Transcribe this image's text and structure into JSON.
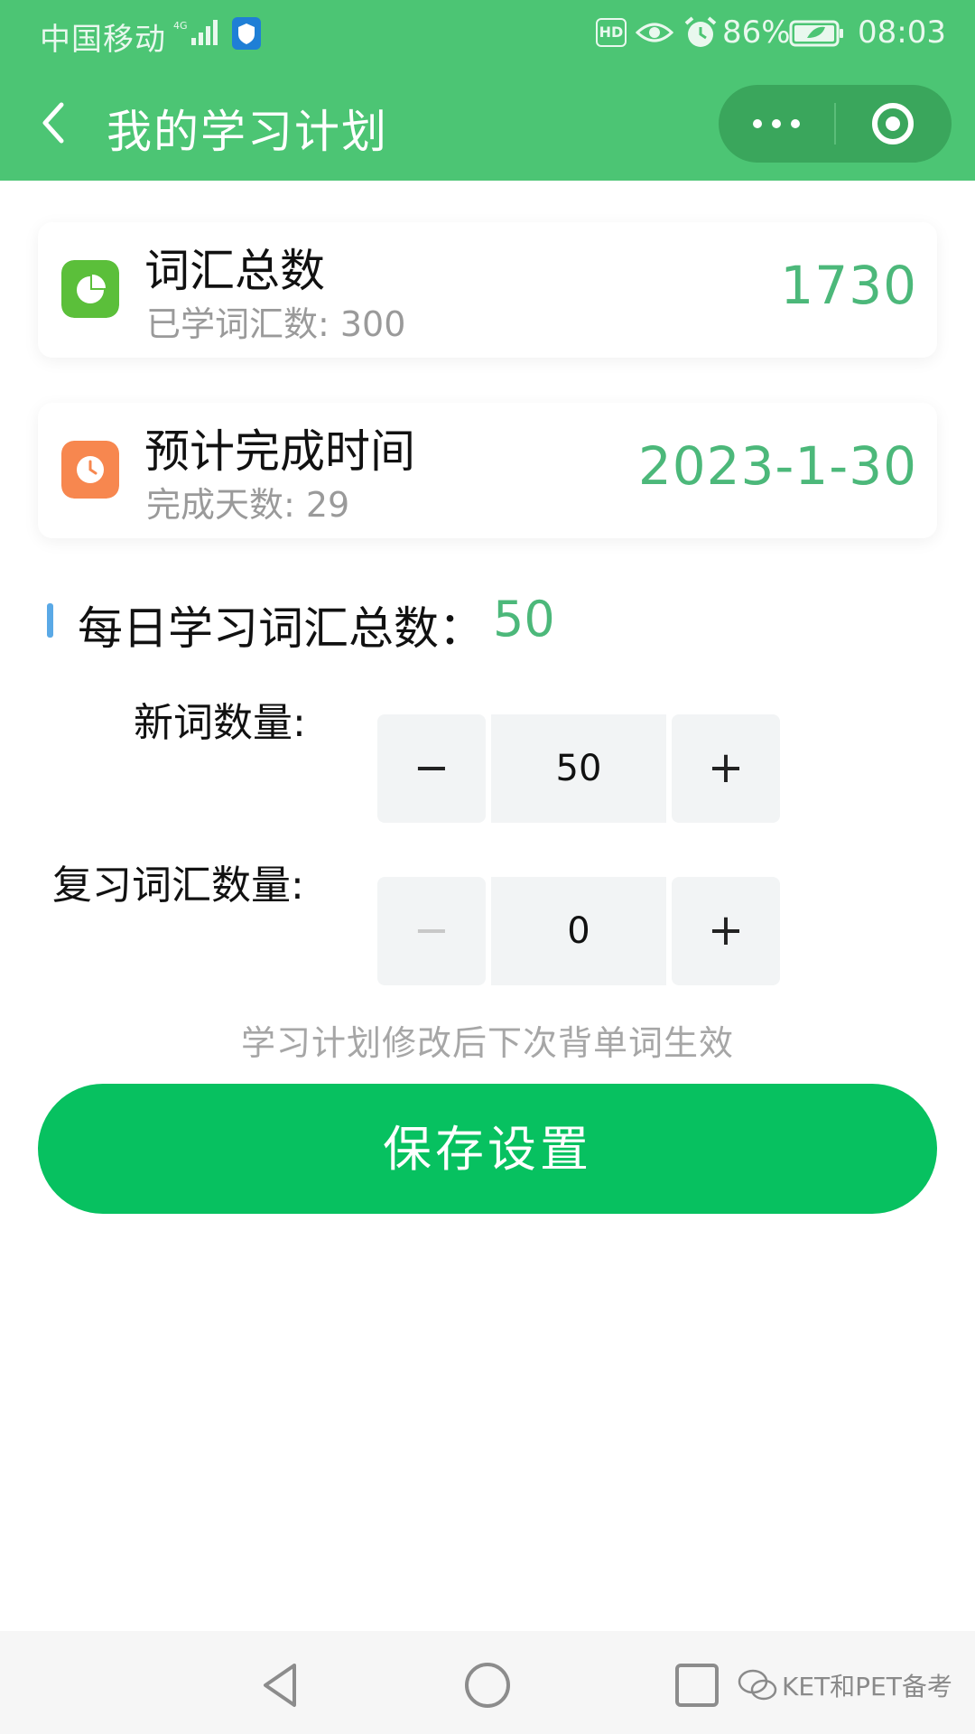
{
  "status_bar": {
    "carrier": "中国移动",
    "network": "4G",
    "battery": "86%",
    "time": "08:03",
    "hd_label": "HD"
  },
  "nav": {
    "title": "我的学习计划"
  },
  "cards": [
    {
      "title": "词汇总数",
      "subtitle": "已学词汇数: 300",
      "value": "1730",
      "icon": "pie-chart-icon",
      "icon_color": "#5bbf3a"
    },
    {
      "title": "预计完成时间",
      "subtitle": "完成天数: 29",
      "value": "2023-1-30",
      "icon": "clock-icon",
      "icon_color": "#f7874f"
    }
  ],
  "daily": {
    "label": "每日学习词汇总数：",
    "value": "50"
  },
  "new_words": {
    "label": "新词数量:",
    "value": "50",
    "minus": "−",
    "plus": "+"
  },
  "review_words": {
    "label": "复习词汇数量:",
    "value": "0",
    "minus": "−",
    "plus": "+"
  },
  "hint": "学习计划修改后下次背单词生效",
  "save_button": "保存设置",
  "watermark": "KET和PET备考",
  "colors": {
    "header": "#4cc574",
    "accent_green": "#4cb87a",
    "save_button": "#07c160",
    "section_bar": "#5aa9e6"
  }
}
